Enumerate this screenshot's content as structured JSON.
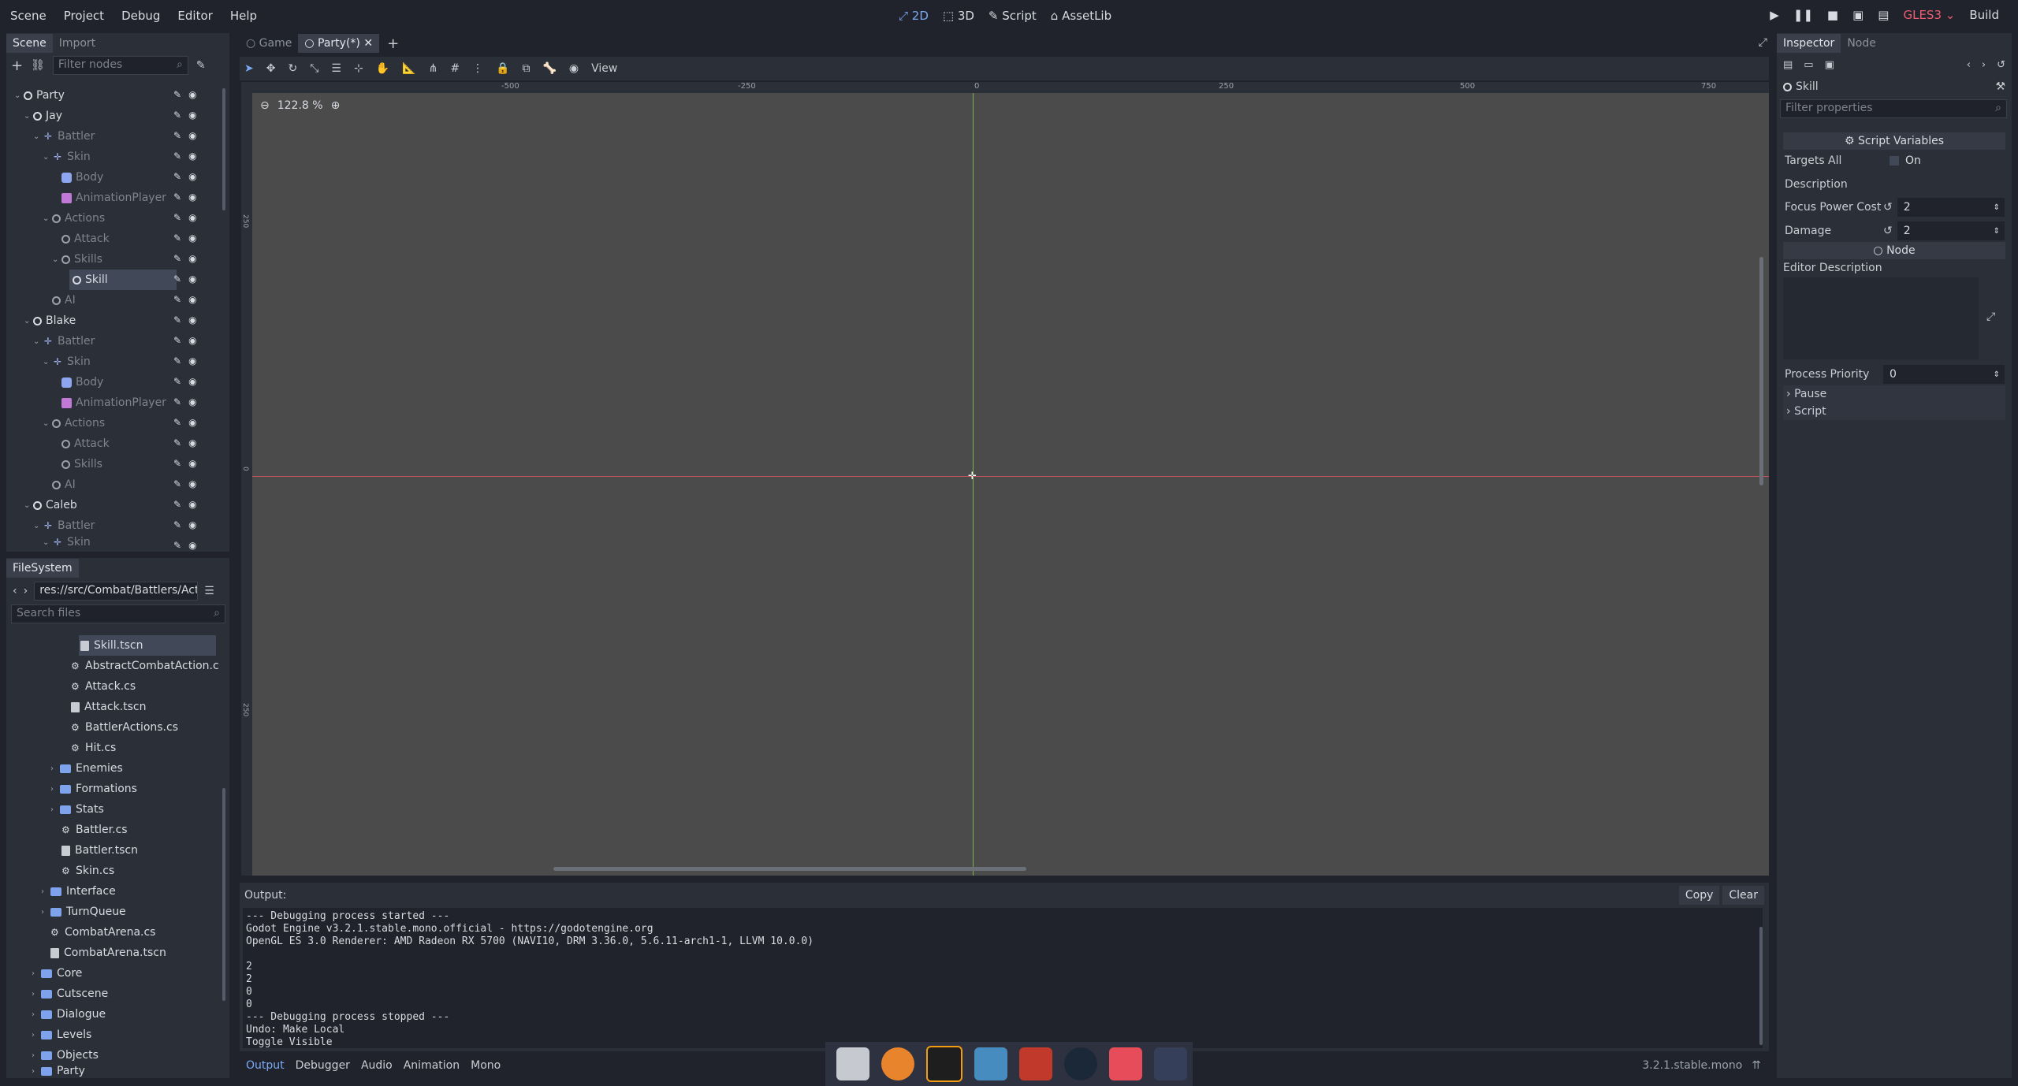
{
  "menu": [
    "Scene",
    "Project",
    "Debug",
    "Editor",
    "Help"
  ],
  "workspaces": [
    {
      "label": "2D",
      "active": true
    },
    {
      "label": "3D",
      "active": false
    },
    {
      "label": "Script",
      "active": false
    },
    {
      "label": "AssetLib",
      "active": false
    }
  ],
  "play": {
    "renderer": "GLES3",
    "build": "Build"
  },
  "scene_dock": {
    "tabs": [
      "Scene",
      "Import"
    ],
    "filter_placeholder": "Filter nodes",
    "tree": [
      {
        "label": "Party"
      },
      {
        "label": "Jay"
      },
      {
        "label": "Battler"
      },
      {
        "label": "Skin"
      },
      {
        "label": "Body"
      },
      {
        "label": "AnimationPlayer"
      },
      {
        "label": "Actions"
      },
      {
        "label": "Attack"
      },
      {
        "label": "Skills"
      },
      {
        "label": "Skill"
      },
      {
        "label": "AI"
      },
      {
        "label": "Blake"
      },
      {
        "label": "Battler"
      },
      {
        "label": "Skin"
      },
      {
        "label": "Body"
      },
      {
        "label": "AnimationPlayer"
      },
      {
        "label": "Actions"
      },
      {
        "label": "Attack"
      },
      {
        "label": "Skills"
      },
      {
        "label": "AI"
      },
      {
        "label": "Caleb"
      },
      {
        "label": "Battler"
      },
      {
        "label": "Skin"
      }
    ]
  },
  "filesystem": {
    "tab": "FileSystem",
    "path": "res://src/Combat/Battlers/Act",
    "search_placeholder": "Search files",
    "items": [
      {
        "label": "Skill.tscn"
      },
      {
        "label": "AbstractCombatAction.c"
      },
      {
        "label": "Attack.cs"
      },
      {
        "label": "Attack.tscn"
      },
      {
        "label": "BattlerActions.cs"
      },
      {
        "label": "Hit.cs"
      },
      {
        "label": "Enemies"
      },
      {
        "label": "Formations"
      },
      {
        "label": "Stats"
      },
      {
        "label": "Battler.cs"
      },
      {
        "label": "Battler.tscn"
      },
      {
        "label": "Skin.cs"
      },
      {
        "label": "Interface"
      },
      {
        "label": "TurnQueue"
      },
      {
        "label": "CombatArena.cs"
      },
      {
        "label": "CombatArena.tscn"
      },
      {
        "label": "Core"
      },
      {
        "label": "Cutscene"
      },
      {
        "label": "Dialogue"
      },
      {
        "label": "Levels"
      },
      {
        "label": "Objects"
      },
      {
        "label": "Party"
      }
    ]
  },
  "editor_tabs": [
    "Game",
    "Party(*)"
  ],
  "toolbar": {
    "view": "View"
  },
  "viewport": {
    "zoom": "122.8 %",
    "ruler_h": [
      "-500",
      "-250",
      "0",
      "250",
      "500",
      "750"
    ],
    "ruler_v": [
      "250",
      "0",
      "250"
    ]
  },
  "inspector": {
    "tabs": [
      "Inspector",
      "Node"
    ],
    "node_name": "Skill",
    "filter_placeholder": "Filter properties",
    "section_script_vars": "Script Variables",
    "props": [
      {
        "key": "Targets All",
        "value": "On"
      },
      {
        "key": "Description",
        "value": ""
      },
      {
        "key": "Focus Power Cost",
        "value": "2"
      },
      {
        "key": "Damage",
        "value": "2"
      }
    ],
    "section_node": "Node",
    "editor_description": "Editor Description",
    "process_priority": {
      "key": "Process Priority",
      "value": "0"
    },
    "groups": [
      "Pause",
      "Script"
    ]
  },
  "output": {
    "title": "Output:",
    "copy": "Copy",
    "clear": "Clear",
    "lines": [
      "--- Debugging process started ---",
      "Godot Engine v3.2.1.stable.mono.official - https://godotengine.org",
      "OpenGL ES 3.0 Renderer: AMD Radeon RX 5700 (NAVI10, DRM 3.36.0, 5.6.11-arch1-1, LLVM 10.0.0)",
      "",
      "2",
      "2",
      "0",
      "0",
      "--- Debugging process stopped ---",
      "Undo: Make Local",
      "Toggle Visible"
    ]
  },
  "bottom_tabs": [
    "Output",
    "Debugger",
    "Audio",
    "Animation",
    "Mono"
  ],
  "version": "3.2.1.stable.mono"
}
